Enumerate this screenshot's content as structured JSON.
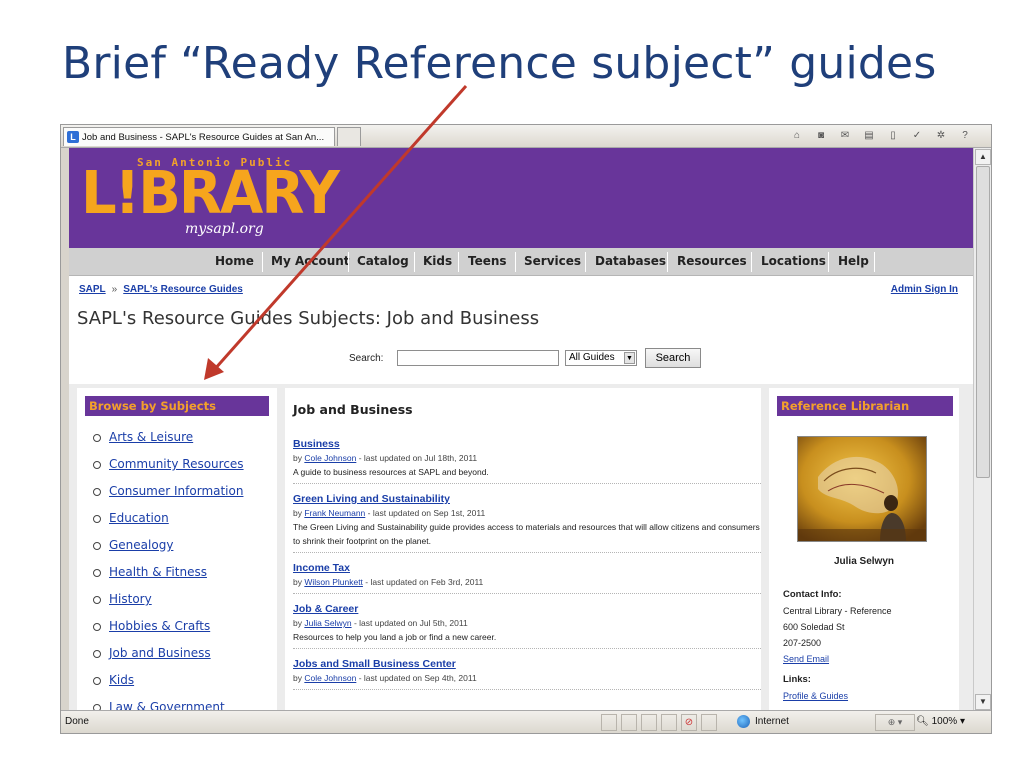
{
  "slide": {
    "title": "Brief “Ready Reference subject” guides"
  },
  "browser": {
    "tab_title": "Job and Business - SAPL's Resource Guides at San An...",
    "status_text": "Done",
    "zone": "Internet",
    "zoom": "100%",
    "command_icons": [
      "home-icon",
      "feeds-icon",
      "mail-icon",
      "print-icon",
      "page-icon",
      "safety-icon",
      "tools-icon",
      "help-icon"
    ]
  },
  "header": {
    "logo_top": "San Antonio Public",
    "logo_main": "L!BRARY",
    "logo_sub": "mysapl.org",
    "colors": {
      "brand_purple": "#68359a",
      "brand_orange": "#f6a51d"
    }
  },
  "nav": {
    "items": [
      "Home",
      "My Account",
      "Catalog",
      "Kids",
      "Teens",
      "Services",
      "Databases",
      "Resources",
      "Locations",
      "Help"
    ]
  },
  "breadcrumb": {
    "items": [
      "SAPL",
      "SAPL's Resource Guides"
    ],
    "separator": "»"
  },
  "admin_link": "Admin Sign In",
  "page_title": "SAPL's Resource Guides Subjects: Job and Business",
  "search": {
    "label": "Search:",
    "value": "",
    "scope": "All Guides",
    "button": "Search"
  },
  "browse": {
    "heading": "Browse by Subjects",
    "subjects": [
      "Arts & Leisure",
      "Community Resources",
      "Consumer Information",
      "Education",
      "Genealogy",
      "Health & Fitness",
      "History",
      "Hobbies & Crafts",
      "Job and Business",
      "Kids",
      "Law & Government"
    ]
  },
  "main": {
    "heading": "Job and Business",
    "guides": [
      {
        "title": "Business",
        "author": "Cole Johnson",
        "updated": "last updated on Jul 18th, 2011",
        "desc": "A guide to business resources at SAPL and beyond."
      },
      {
        "title": "Green Living and Sustainability",
        "author": "Frank Neumann",
        "updated": "last updated on Sep 1st, 2011",
        "desc": "The Green Living and Sustainability guide provides access to materials and resources that will allow citizens and consumers to shrink their footprint on the planet."
      },
      {
        "title": "Income Tax",
        "author": "Wilson Plunkett",
        "updated": "last updated on Feb 3rd, 2011",
        "desc": ""
      },
      {
        "title": "Job & Career",
        "author": "Julia Selwyn",
        "updated": "last updated on Jul 5th, 2011",
        "desc": "Resources to help you land a job or find a new career."
      },
      {
        "title": "Jobs and Small Business Center",
        "author": "Cole Johnson",
        "updated": "last updated on Sep 4th, 2011",
        "desc": ""
      }
    ]
  },
  "librarian": {
    "heading": "Reference Librarian",
    "name": "Julia Selwyn",
    "contact_label": "Contact Info:",
    "contact_lines": [
      "Central Library - Reference",
      "600 Soledad St",
      "207-2500"
    ],
    "email_link": "Send Email",
    "links_label": "Links:",
    "profile_link": "Profile & Guides"
  },
  "annotation": {
    "arrow_color": "#c0392b"
  }
}
